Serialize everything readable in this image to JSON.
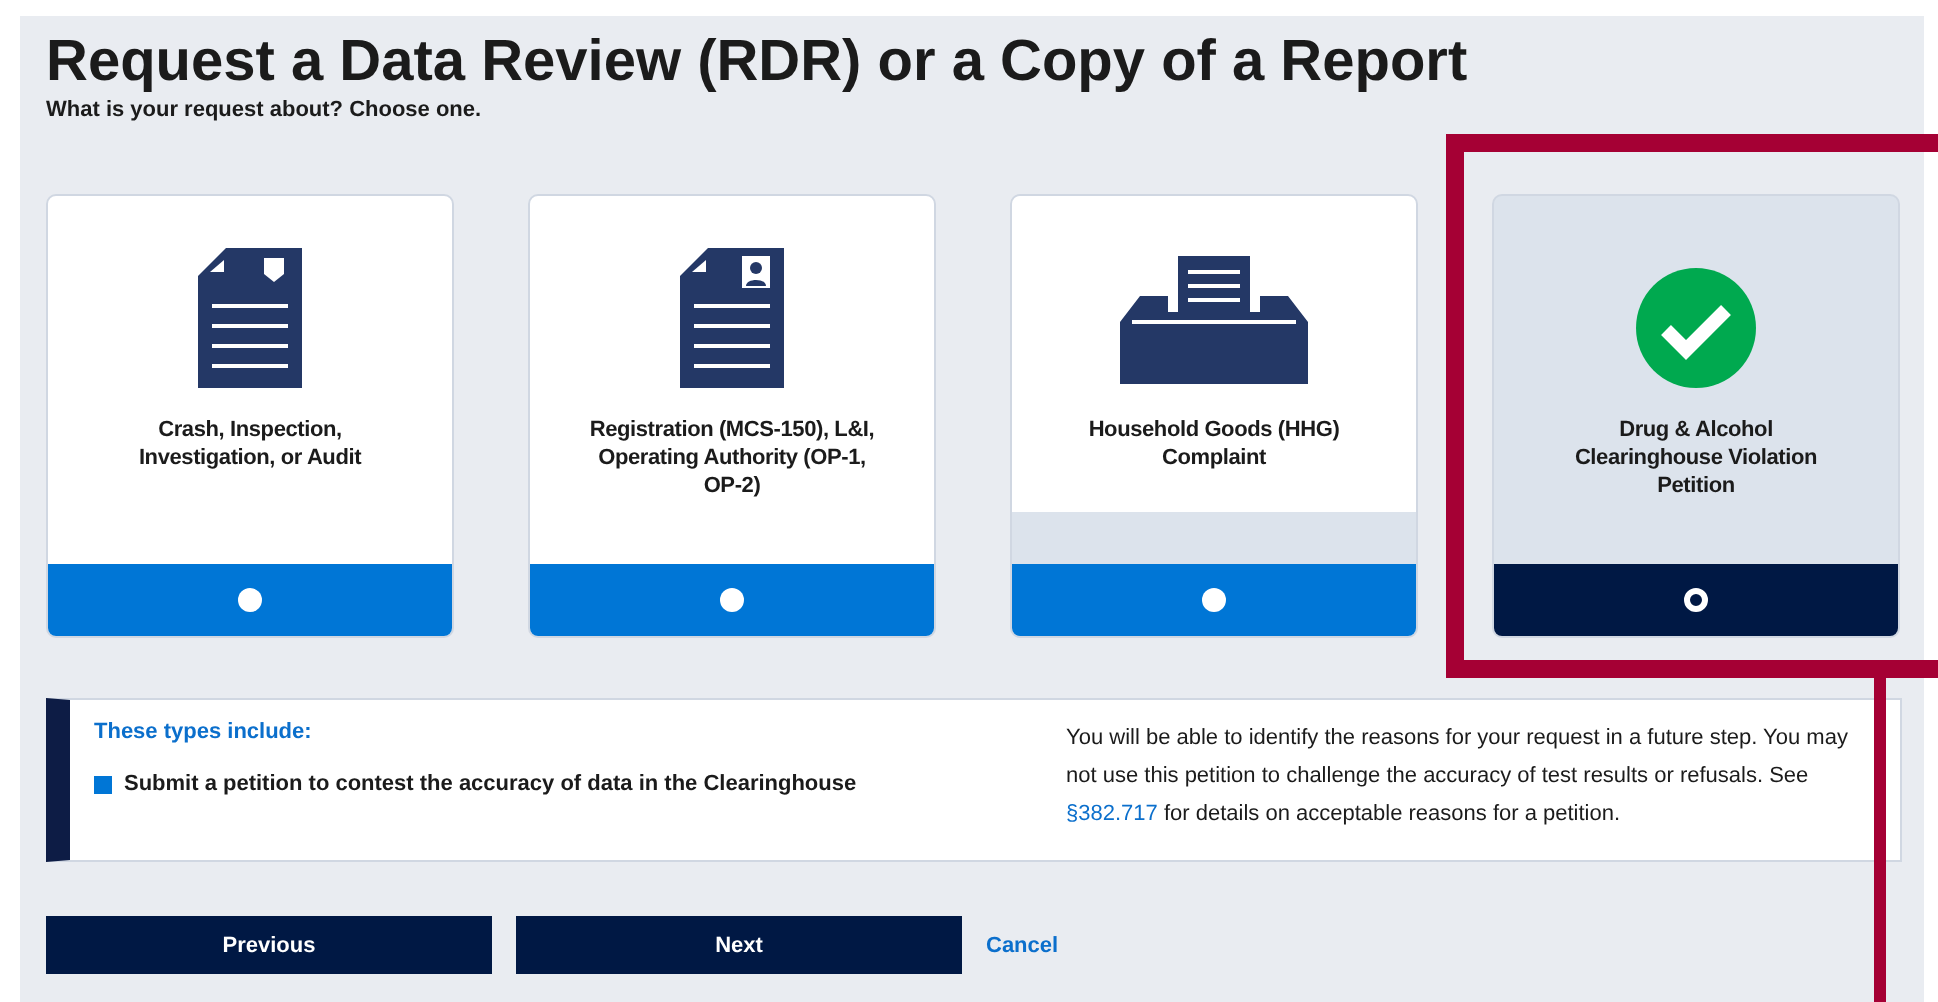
{
  "title": "Request a Data Review (RDR) or a Copy of a Report",
  "subtitle": "What is your request about? Choose one.",
  "options": [
    {
      "label": "Crash, Inspection, Investigation, or Audit",
      "kind": "report-badge",
      "selected": false,
      "hovered": false
    },
    {
      "label": "Registration (MCS-150), L&I, Operating Authority (OP-1, OP-2)",
      "kind": "report-person",
      "selected": false,
      "hovered": false
    },
    {
      "label": "Household Goods (HHG) Complaint",
      "kind": "inbox",
      "selected": false,
      "hovered": true
    },
    {
      "label": "Drug & Alcohol Clearinghouse Violation Petition",
      "kind": "check",
      "selected": true,
      "hovered": false
    }
  ],
  "details": {
    "heading": "These types include:",
    "items": [
      "Submit a petition to contest the accuracy of data in the Clearinghouse"
    ],
    "note_before": "You will be able to identify the reasons for your request in a future step. You may not use this petition to challenge the accuracy of test results or refusals. See",
    "note_link": "§382.717",
    "note_after": "for details on acceptable reasons for a petition."
  },
  "buttons": [
    "Previous",
    "Next"
  ],
  "cancel": "Cancel"
}
